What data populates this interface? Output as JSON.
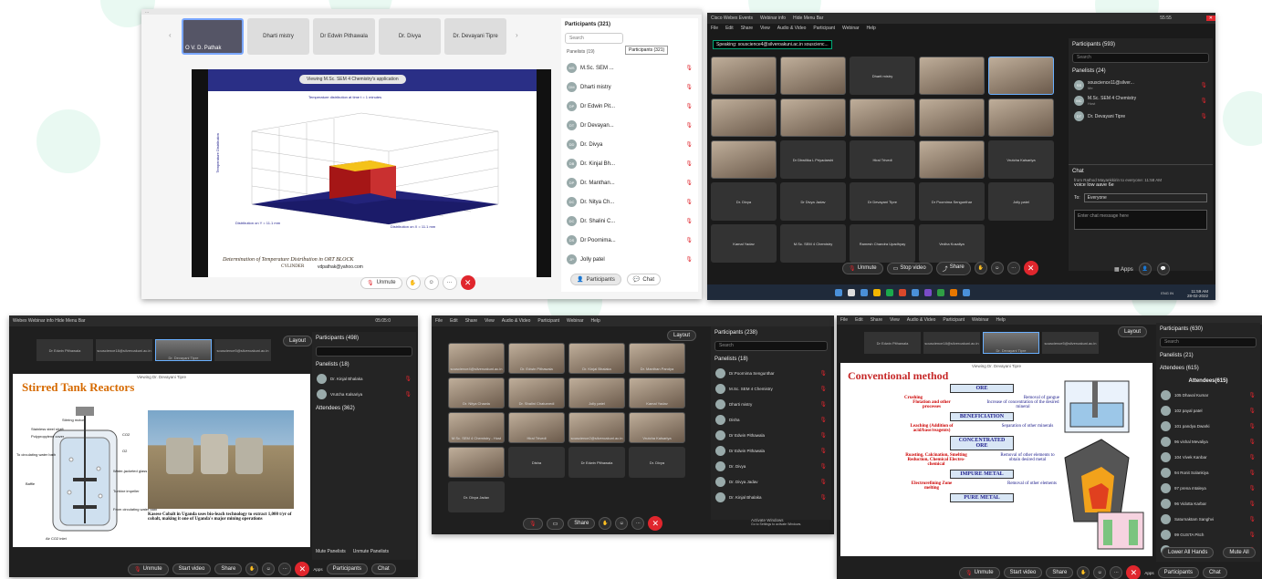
{
  "s1": {
    "topbar": "...",
    "self_tile": "O V. D. Pathak",
    "tiles": [
      "Dharti mistry",
      "Dr Edwin Pithawala",
      "Dr. Divya",
      "Dr. Devayani Tipre"
    ],
    "share_notice": "Viewing M.Sc. SEM 4 Chemistry's application",
    "plot_title": "Temperature distribution at time t = 1 minutes",
    "ylabel": "Temperature Distribution",
    "xlabel1": "Distribution on Y = 11.1 mm",
    "xlabel2": "Distribution on X = 11.1 mm",
    "caption": "Determination of Temperature Distribution in ORT BLOCK",
    "caption2": "CYLINDER",
    "email": "vdpathak@yahoo.com",
    "panel_title": "Participants (321)",
    "search_placeholder": "Search",
    "tooltip": "Participants (321)",
    "panelists": "Panelists (19)",
    "participants": [
      {
        "initials": "MS",
        "name": "M.Sc. SEM ...",
        "sub": "Host"
      },
      {
        "initials": "DM",
        "name": "Dharti mistry"
      },
      {
        "initials": "DP",
        "name": "Dr Edwin Pit..."
      },
      {
        "initials": "DT",
        "name": "Dr Devayan..."
      },
      {
        "initials": "DD",
        "name": "Dr. Divya"
      },
      {
        "initials": "DB",
        "name": "Dr. Kinjal Bh..."
      },
      {
        "initials": "DP",
        "name": "Dr. Manthan..."
      },
      {
        "initials": "DC",
        "name": "Dr. Nitya Ch..."
      },
      {
        "initials": "DC",
        "name": "Dr. Shalini C..."
      },
      {
        "initials": "DS",
        "name": "Dr Poornima..."
      },
      {
        "initials": "JP",
        "name": "Jolly patel"
      }
    ],
    "unmute": "Unmute",
    "participants_btn": "Participants",
    "chat_btn": "Chat"
  },
  "s2": {
    "title": "Cisco Webex Events",
    "webinar_info": "Webinar info",
    "hide_menu": "Hide Menu Bar",
    "time": "55:55",
    "menu": [
      "File",
      "Edit",
      "Share",
      "View",
      "Audio & Video",
      "Participant",
      "Webinar",
      "Help"
    ],
    "speaking": "Speaking: souscience4@silveroakuni.ac.in souscienc...",
    "tiles": [
      {
        "label": "",
        "cam": true
      },
      {
        "label": "",
        "cam": true
      },
      {
        "label": "Dharti mistry",
        "cam": false
      },
      {
        "label": "",
        "cam": true
      },
      {
        "label": "",
        "cam": true,
        "hl": true
      },
      {
        "label": "",
        "cam": true
      },
      {
        "label": "",
        "cam": true
      },
      {
        "label": "",
        "cam": true
      },
      {
        "label": "",
        "cam": true
      },
      {
        "label": "",
        "cam": true
      },
      {
        "label": "",
        "cam": true
      },
      {
        "label": "Dr Dhwilika L Priyadarshi",
        "cam": false
      },
      {
        "label": "Hiral Trivedi",
        "cam": false
      },
      {
        "label": "",
        "cam": true
      },
      {
        "label": "Vrutcha Kalsariya",
        "cam": false
      },
      {
        "label": "Dr. Divya",
        "cam": false
      },
      {
        "label": "Dr Divya Jadav",
        "cam": false
      },
      {
        "label": "Dr Devayani Tipre",
        "cam": false
      },
      {
        "label": "Dr Poornima Sengunthar",
        "cam": false
      },
      {
        "label": "Jolly patel",
        "cam": false
      }
    ],
    "tiles_row5": [
      "Kamal Yadav",
      "M.Sc. SEM 4 Chemistry",
      "Ramesh Chandra Upadhyay",
      "Vedha Kusaliya"
    ],
    "panel_title": "Participants (593)",
    "search": "Search",
    "panelists": "Panelists (24)",
    "rows": [
      {
        "initials": "SS",
        "name": "souscience11@silver...",
        "sub": "Me"
      },
      {
        "initials": "MC",
        "name": "M.Sc. SEM 4 Chemistry",
        "sub": "Host"
      },
      {
        "initials": "DT",
        "name": "Dr. Devayani Tipre",
        "sub": ""
      }
    ],
    "chat_title": "Chat",
    "chat_meta": "from Rathod Mayankkirin to everyone:  11:58 AM",
    "chat_text": "voice low aave 6e",
    "to_label": "To:",
    "to_value": "Everyone",
    "chat_placeholder": "Enter chat message here",
    "unmute": "Unmute",
    "stop_video": "Stop video",
    "share": "Share",
    "apps": "Apps",
    "clock_time": "11:59 AM",
    "clock_date": "28-02-2022",
    "tray": "ENG IN"
  },
  "s3": {
    "title": "Webex   Webinar info   Hide Menu Bar",
    "time": "05:05:0",
    "thumbs": [
      "Dr Edwin Pithawala",
      "souscience18@silveroakuni.ac.in",
      "Dr. Devayani Tipre",
      "souscience5@silveroakuni.ac.in"
    ],
    "layout": "Layout",
    "viewing": "Viewing Dr. Devayani Tipre",
    "heading": "Stirred Tank Reactors",
    "labels": [
      "Stirring motor",
      "Stainless steel shaft",
      "Polypropylene cover",
      "To circulating water bath",
      "Baffle",
      "Air CO2 inlet",
      "Water-jacketed glass container",
      "Turbine impeller",
      "From circulating water bath",
      "CO2",
      "O2"
    ],
    "body": "Kasese Cobalt in Uganda uses bio-leach technology to extract 1,000 t/yr of cobalt, making it one of Uganda's major mining operations",
    "panel_title": "Participants (498)",
    "panelists": "Panelists (18)",
    "rows": [
      "Dr. Kinjal Bhalaka",
      "Vrutcha Kalsariya"
    ],
    "attendees": "Attendees (362)",
    "mute_all": "Mute Panelists",
    "unmute_panelists": "Unmute Panelists",
    "unmute": "Unmute",
    "start_video": "Start video",
    "share": "Share",
    "apps": "Apps",
    "participants": "Participants",
    "chat": "Chat"
  },
  "s4": {
    "layout": "Layout",
    "tiles": [
      "souscience4@silveroakuni.ac.in",
      "Dr. Edwin Pithawala",
      "Dr. Kinjal Bhalaka",
      "Dr. Manthan Pandya",
      "Dr. Nitya Chawla",
      "Dr. Shalini Chaturvedi",
      "Jolly patel",
      "Kamal Yadav",
      "M.Sc. SEM 4 Chemistry - Host",
      "Hiral Trivedi",
      "souscience2@silveroakuni.ac.in",
      "Vrutcha Kalsariya",
      "",
      "Disha",
      "Dr Edwin Pithawala",
      "Dr. Divya",
      "Dr. Divya Jadav"
    ],
    "panel_title": "Participants (238)",
    "search": "Search",
    "panelists": "Panelists (18)",
    "rows": [
      "Dr.Poornima Sengunthar",
      "M.Sc. SEM 4 Chemistry",
      "Dharti mistry",
      "Disha",
      "Dr Edwin Pithawala",
      "Dr Edwin Pithawala",
      "Dr. Divya",
      "Dr. Divya Jadav",
      "Dr. Kinjal Bhalaka"
    ],
    "share": "Share",
    "activate": "Activate Windows",
    "activate_sub": "Go to Settings to activate Windows."
  },
  "s5": {
    "thumbs": [
      "Dr Edwin Pithawala",
      "souscience18@silveroakuni.ac.in",
      "Dr. Devayani Tipre",
      "souscience5@silveroakuni.ac.in"
    ],
    "layout": "Layout",
    "viewing": "Viewing Dr. Devayani Tipre",
    "heading": "Conventional method",
    "ore": "ORE",
    "crushing": "Crushing",
    "removal_gangue": "Removal of gangue",
    "flotation": "Flotation and other processes",
    "increase": "Increase of concentration of the desired mineral",
    "beneficiation": "BENEFICIATION",
    "leaching": "Leaching (Addition of acid/base/reagents)",
    "separation": "Separation of other minerals",
    "concentrated": "CONCENTRATED ORE",
    "roasting": "Roasting, Calcination, Smelting Reduction, Chemical Electro-chemical",
    "removal_other": "Removal of other elements to obtain desired metal",
    "impure": "IMPURE METAL",
    "electro": "Electrorefining Zone melting",
    "removal_other2": "Removal of other elements",
    "pure": "PURE METAL",
    "panel_title": "Participants (630)",
    "search": "Search",
    "panelists": "Panelists (21)",
    "attendees": "Attendees (615)",
    "attendees_head": "Attendees(615)",
    "rows": [
      "105 Dhaval Kumar",
      "102 payal patel",
      "101 pandya Dwarki",
      "96 vishal Mevaliya",
      "104 Vivek Kanbar",
      "94 Ronit Solankiya",
      "97 prena mtaleya",
      "96 Vidotta Karbar",
      "Saturnaktam Sanghvi",
      "99 GUSTA Pitch",
      "99 Janki Anasdiyaa"
    ],
    "lower_hands": "Lower All Hands",
    "mute_all": "Mute All",
    "unmute": "Unmute",
    "start_video": "Start video",
    "share": "Share",
    "apps": "Apps",
    "participants": "Participants",
    "chat": "Chat"
  }
}
